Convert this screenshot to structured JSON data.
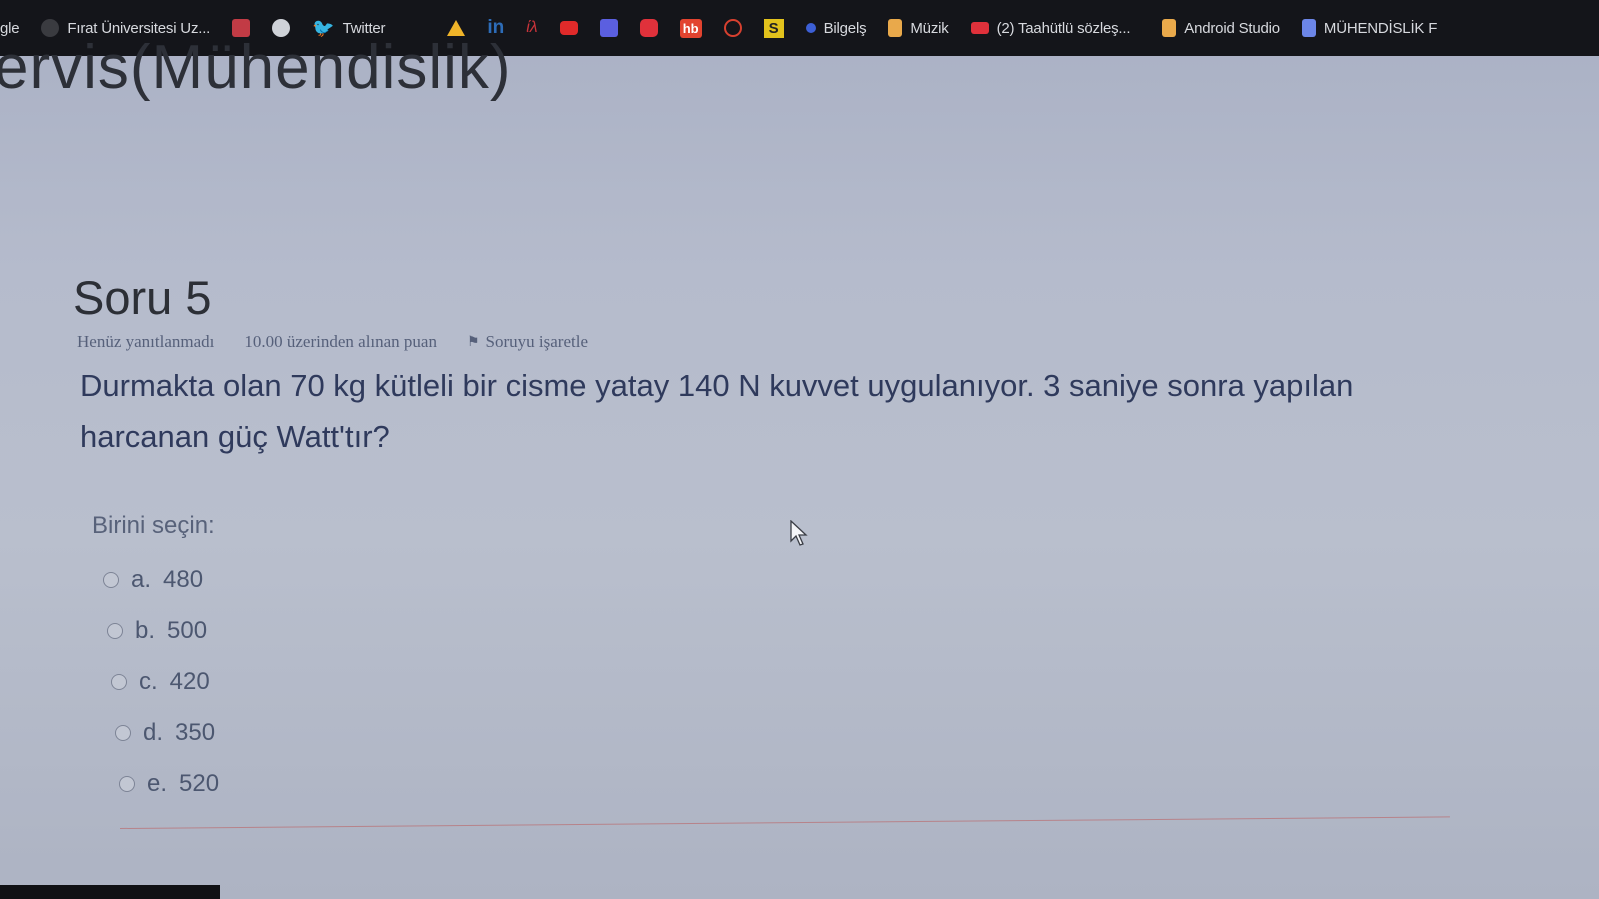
{
  "bookmarks": [
    {
      "label": "gle",
      "color": ""
    },
    {
      "label": "Fırat Üniversitesi Uz...",
      "color": "#3a3b40"
    },
    {
      "label": "",
      "color": "#c23b45"
    },
    {
      "label": "",
      "color": "#cfd2d8"
    },
    {
      "label": "Twitter",
      "color": "#3d9be9"
    },
    {
      "label": "",
      "color": "#f0b429"
    },
    {
      "label": "in",
      "color": "#2d6cb8"
    },
    {
      "label": "",
      "color": "#c8333a"
    },
    {
      "label": "",
      "color": "#e02a2a"
    },
    {
      "label": "",
      "color": "#5b5fe0"
    },
    {
      "label": "",
      "color": "#e0313b"
    },
    {
      "label": "hb",
      "color": "#e2432f"
    },
    {
      "label": "",
      "color": "#d7402f"
    },
    {
      "label": "S",
      "color": "#e2c21c"
    },
    {
      "label": "Bilgelş",
      "color": "#3c5fd6"
    },
    {
      "label": "Müzik",
      "color": "#e9a94b"
    },
    {
      "label": "(2) Taahütlü sözleş...",
      "color": "#e0313b"
    },
    {
      "label": "Android Studio",
      "color": "#e9a94b"
    },
    {
      "label": "MÜHENDİSLİK F",
      "color": "#6c86e8"
    }
  ],
  "page_heading": "ervis(Mühendislik)",
  "question": {
    "title": "Soru 5",
    "status": "Henüz yanıtlanmadı",
    "points": "10.00 üzerinden alınan puan",
    "flag_label": "Soruyu işaretle",
    "text": "Durmakta olan 70 kg kütleli bir cisme yatay 140 N kuvvet uygulanıyor. 3 saniye sonra yapılan harcanan güç Watt'tır?",
    "select_label": "Birini seçin:",
    "options": [
      {
        "letter": "a.",
        "value": "480"
      },
      {
        "letter": "b.",
        "value": "500"
      },
      {
        "letter": "c.",
        "value": "420"
      },
      {
        "letter": "d.",
        "value": "350"
      },
      {
        "letter": "e.",
        "value": "520"
      }
    ]
  }
}
